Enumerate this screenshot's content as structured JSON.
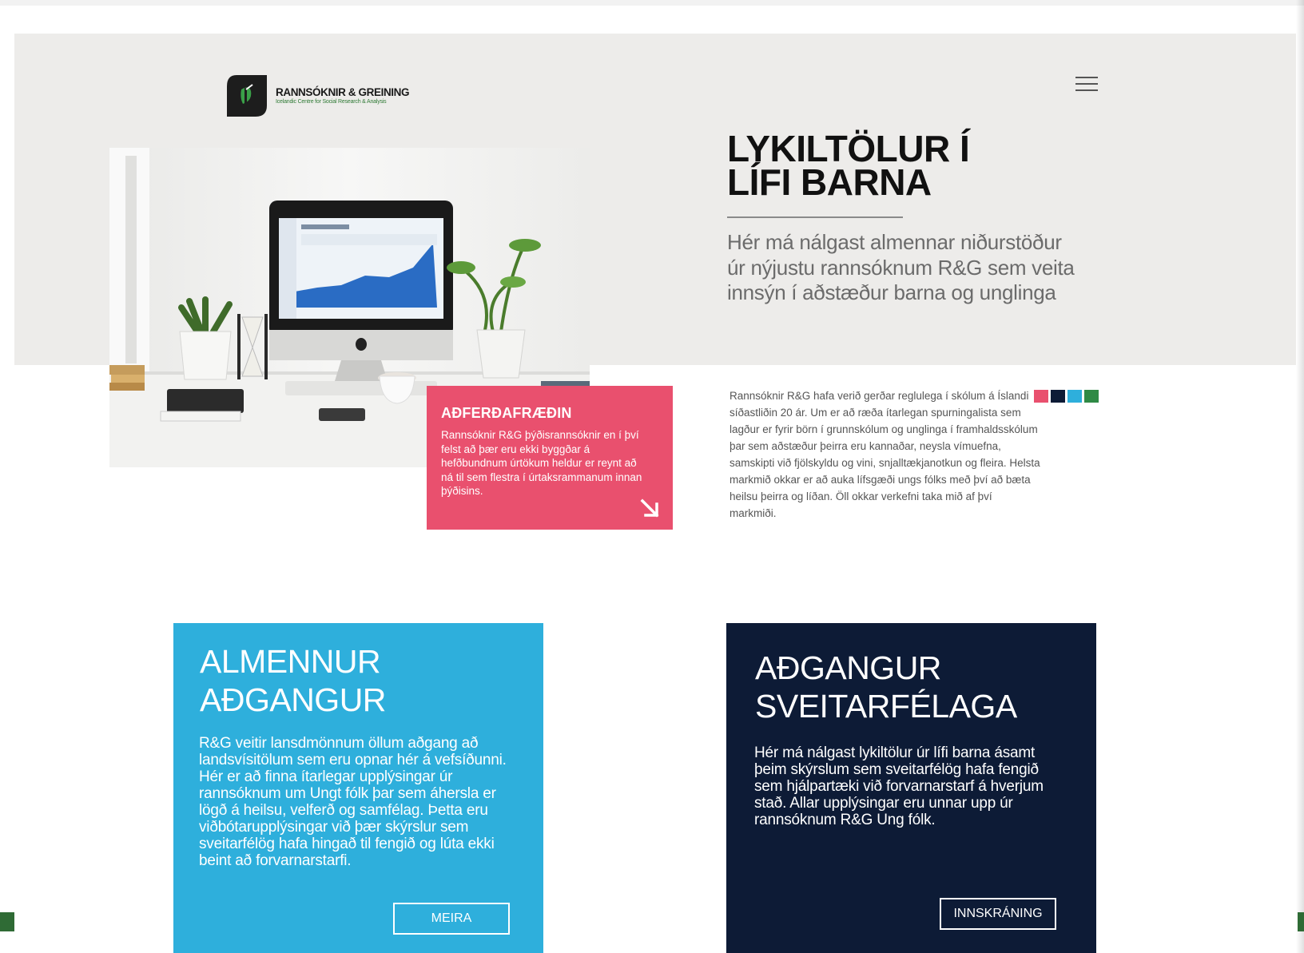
{
  "brand": {
    "name": "RANNSÓKNIR & GREINING",
    "tagline": "Icelandic Centre for Social Research & Analysis",
    "colors": {
      "green": "#2f7a35",
      "dark": "#1a1a1a"
    }
  },
  "header": {
    "menu_icon": "hamburger-menu-icon"
  },
  "hero": {
    "title_line1": "LYKILTÖLUR Í",
    "title_line2": "LÍFI BARNA",
    "subtitle": "Hér má nálgast almennar niðurstöður úr nýjustu rannsóknum R&G sem veita innsýn í aðstæður barna og unglinga",
    "intro": "Rannsóknir R&G hafa verið gerðar reglulega í  skólum á Íslandi síðastliðin 20 ár.  Um er að ræða ítarlegan spurningalista sem lagður er fyrir börn í grunnskólum og unglinga í framhaldsskólum þar sem  aðstæður þeirra eru kannaðar, neysla vímuefna, samskipti við fjölskyldu og vini, snjalltækjanotkun og fleira. Helsta markmið okkar er að auka lífsgæði ungs fólks með því að bæta heilsu þeirra og líðan. Öll okkar verkefni taka mið af því markmiði.",
    "swatches": [
      "#e9506e",
      "#0d1b36",
      "#2eafdc",
      "#2f8a45"
    ]
  },
  "method_card": {
    "title": "AÐFERÐAFRÆÐIN",
    "text": "Rannsóknir R&G þýðisrannsóknir en í því felst að þær eru ekki byggðar á hefðbundnum úrtökum heldur er reynt að ná til sem flestra í úrtaksrammanum innan þýðisins.",
    "color": "#e9506e",
    "arrow_icon": "arrow-down-right-icon"
  },
  "cards": {
    "public": {
      "title_line1": "ALMENNUR",
      "title_line2": "AÐGANGUR",
      "text": "R&G veitir lansdmönnum öllum aðgang að landsvísitölum sem eru opnar hér á vefsíðunni. Hér er að finna ítarlegar upplýsingar úr rannsóknum um Ungt fólk þar sem áhersla er lögð á heilsu, velferð og samfélag. Þetta eru viðbótarupplýsingar við þær skýrslur sem sveitarfélög hafa hingað til fengið og lúta ekki beint að forvarnarstarfi.",
      "button": "MEIRA",
      "color": "#2eafdc"
    },
    "municipal": {
      "title_line1": "AÐGANGUR",
      "title_line2": "SVEITARFÉLAGA",
      "text": "Hér má nálgast lykiltölur úr lífi barna ásamt þeim skýrslum sem sveitarfélög hafa fengið sem hjálpartæki við forvarnarstarf á hverjum stað. Allar upplýsingar eru unnar upp úr rannsóknum R&G  Ung fólk.",
      "button": "INNSKRÁNING",
      "color": "#0d1b36"
    }
  }
}
